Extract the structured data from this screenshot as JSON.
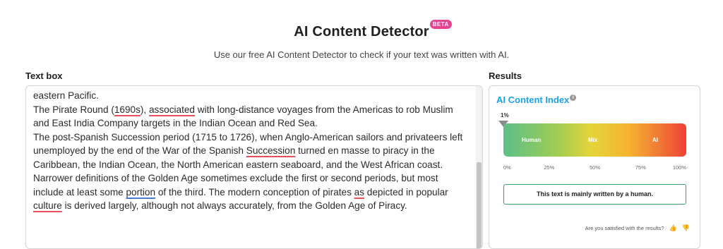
{
  "header": {
    "title": "AI Content Detector",
    "beta": "BETA",
    "subtitle": "Use our free AI Content Detector to check if your text was written with AI."
  },
  "textbox": {
    "label": "Text box",
    "paragraphs": [
      {
        "lines": [
          "eastern Pacific."
        ]
      },
      {
        "segments": [
          {
            "text": "The Pirate Round (",
            "mark": ""
          },
          {
            "text": "1690s",
            "mark": "spell"
          },
          {
            "text": "), ",
            "mark": ""
          },
          {
            "text": "associated",
            "mark": "spell"
          },
          {
            "text": " with long-distance voyages from the Americas to rob Muslim and East India Company targets in the Indian Ocean and Red Sea.",
            "mark": ""
          }
        ]
      },
      {
        "segments": [
          {
            "text": "The post-Spanish Succession period (1715 to 1726), when Anglo-American sailors and privateers left unemployed by the end of the War of the Spanish ",
            "mark": ""
          },
          {
            "text": "Succession",
            "mark": "spell"
          },
          {
            "text": " turned en masse to piracy in the Caribbean, the Indian Ocean, the North American eastern seaboard, and the West African coast.",
            "mark": ""
          }
        ]
      },
      {
        "segments": [
          {
            "text": "Narrower definitions of the Golden Age sometimes exclude the first or second periods, but most include at least some ",
            "mark": ""
          },
          {
            "text": "portion",
            "mark": "grammar"
          },
          {
            "text": " of the third. The modern conception of pirates ",
            "mark": ""
          },
          {
            "text": "as",
            "mark": "spell"
          },
          {
            "text": " depicted in popular ",
            "mark": ""
          },
          {
            "text": "culture",
            "mark": "spell"
          },
          {
            "text": " is derived largely, although not always accurately, from the Golden Age of Piracy.",
            "mark": ""
          }
        ]
      }
    ]
  },
  "results": {
    "label": "Results",
    "index_title": "AI Content Index",
    "info_icon": "i",
    "score_label": "1%",
    "score_value": 1,
    "bar_labels": {
      "human": "Human",
      "mix": "Mix",
      "ai": "AI"
    },
    "ticks": [
      "0%",
      "25%",
      "50%",
      "75%",
      "100%"
    ],
    "verdict": "This text is mainly written by a human.",
    "feedback_question": "Are you satisfied with the results?",
    "thumbs_up_icon": "thumbs-up-icon",
    "thumbs_down_icon": "thumbs-down-icon",
    "colors": {
      "accent": "#1aa3e8",
      "verdict_border": "#3aa36c",
      "beta": "#e84393",
      "spell": "#e8505b",
      "grammar": "#4a7bd6"
    }
  }
}
